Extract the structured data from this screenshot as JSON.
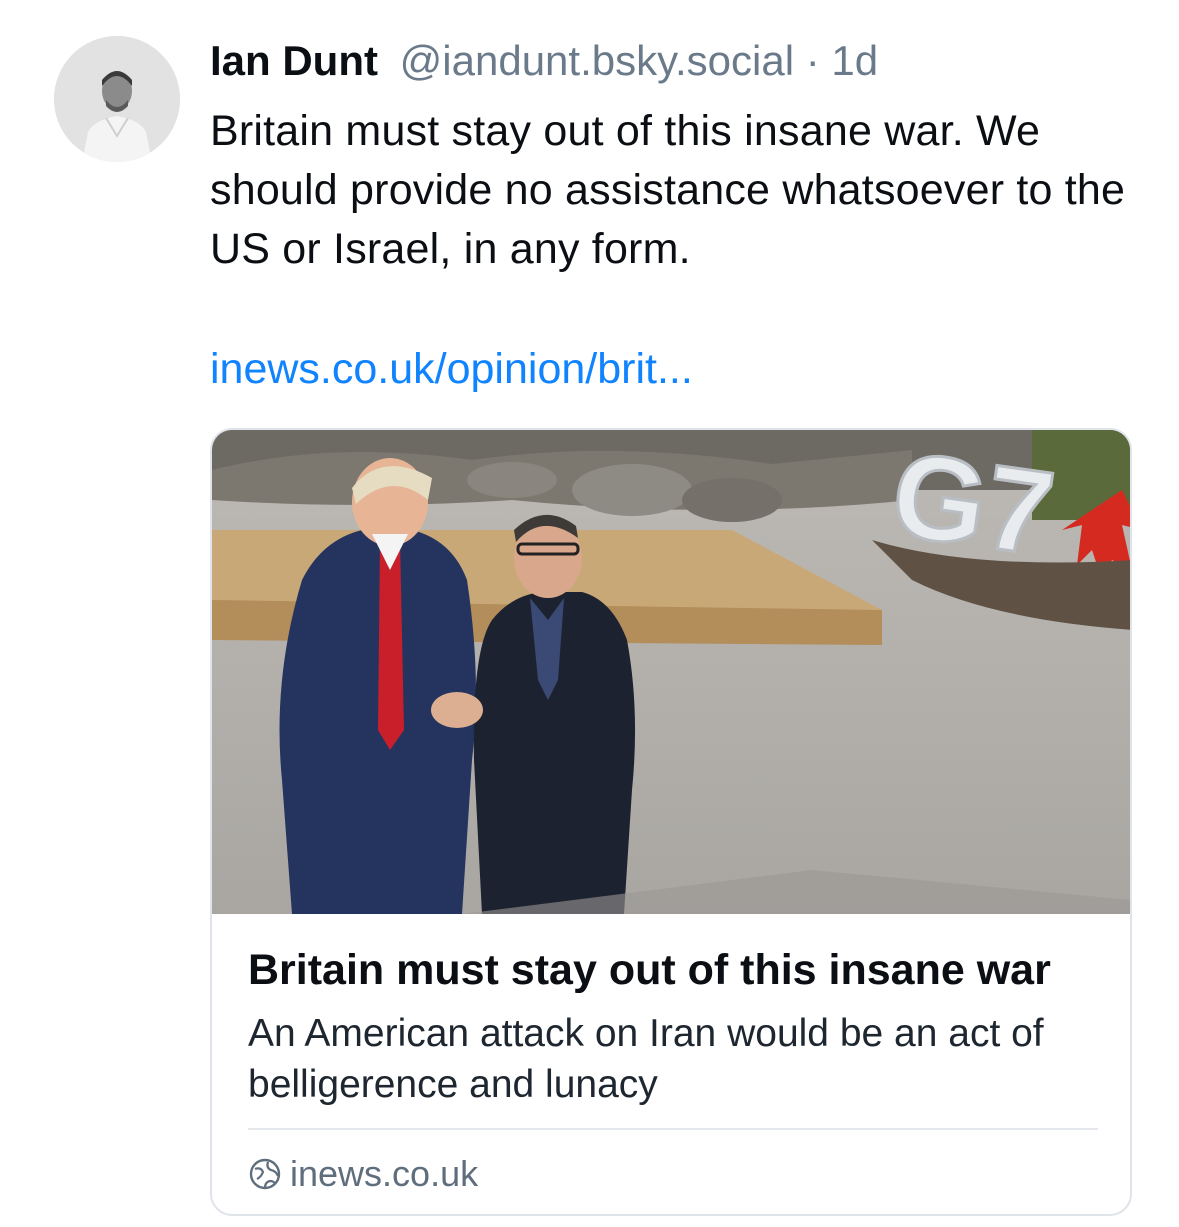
{
  "author": {
    "name": "Ian Dunt",
    "handle": "@iandunt.bsky.social",
    "separator": "·",
    "time": "1d",
    "avatar_icon": "avatar-photo"
  },
  "post": {
    "text": "Britain must stay out of this insane war. We should provide no assistance whatsoever to the US or Israel, in any form.",
    "link_text": "inews.co.uk/opinion/brit..."
  },
  "embed": {
    "title": "Britain must stay out of this insane war",
    "description": "An American attack on Iran would be an act of belligerence and lunacy",
    "domain": "inews.co.uk",
    "image_sign_text": "G7",
    "domain_icon": "globe-icon"
  },
  "colors": {
    "link": "#1083fe",
    "muted": "#6b7a8a",
    "border": "#dfe4ea"
  }
}
